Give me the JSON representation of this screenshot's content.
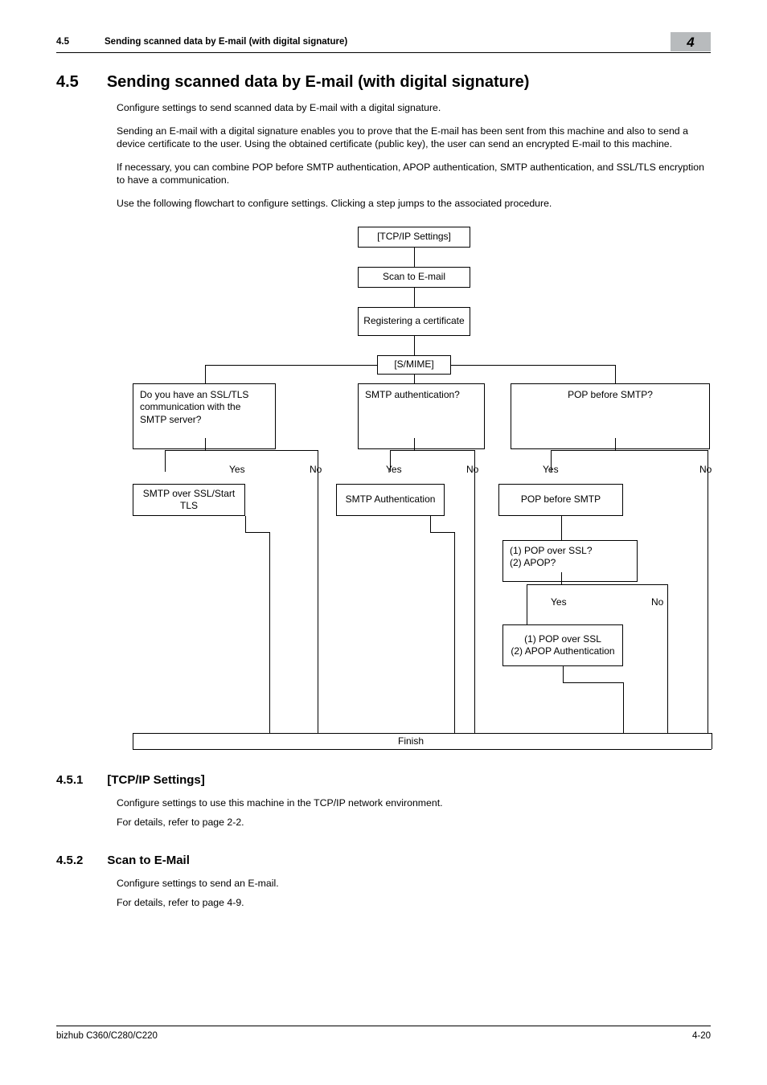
{
  "header": {
    "section_num": "4.5",
    "section_title": "Sending scanned data by E-mail (with digital signature)",
    "chapter_tab": "4"
  },
  "h1": {
    "num": "4.5",
    "title": "Sending scanned data by E-mail (with digital signature)"
  },
  "paras": {
    "p1": "Configure settings to send scanned data by E-mail with a digital signature.",
    "p2": "Sending an E-mail with a digital signature enables you to prove that the E-mail has been sent from this machine and also to send a device certificate to the user. Using the obtained certificate (public key), the user can send an encrypted E-mail to this machine.",
    "p3": "If necessary, you can combine POP before SMTP authentication, APOP authentication, SMTP authentication, and SSL/TLS encryption to have a communication.",
    "p4": "Use the following flowchart to configure settings. Clicking a step jumps to the associated procedure."
  },
  "flow": {
    "tcpip": "[TCP/IP Settings]",
    "scan": "Scan to E-mail",
    "cert": "Registering a certificate",
    "smime": "[S/MIME]",
    "ssl_q": "Do you have an SSL/TLS communication with the SMTP server?",
    "smtp_q": "SMTP authentication?",
    "pop_q": "POP before SMTP?",
    "ssl_a": "SMTP over SSL/Start TLS",
    "smtp_a": "SMTP Authentication",
    "pop_a": "POP before SMTP",
    "pop_q2": "(1) POP over SSL?\n(2) APOP?",
    "pop_a2": "(1) POP over SSL\n(2) APOP Authentication",
    "finish": "Finish",
    "yes": "Yes",
    "no": "No"
  },
  "sub1": {
    "num": "4.5.1",
    "title": "[TCP/IP Settings]",
    "p1": "Configure settings to use this machine in the TCP/IP network environment.",
    "p2": "For details, refer to page 2-2."
  },
  "sub2": {
    "num": "4.5.2",
    "title": "Scan to E-Mail",
    "p1": "Configure settings to send an E-mail.",
    "p2": "For details, refer to page 4-9."
  },
  "footer": {
    "product": "bizhub C360/C280/C220",
    "page": "4-20"
  }
}
